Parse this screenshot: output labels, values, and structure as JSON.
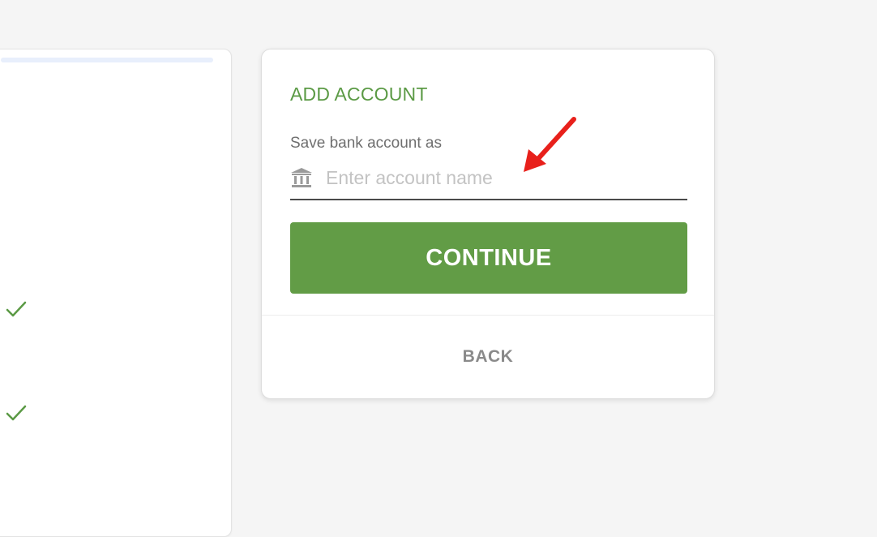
{
  "left_panel": {
    "progress_fraction": 1.0,
    "checks": [
      "check-icon",
      "check-icon"
    ]
  },
  "card": {
    "title": "ADD ACCOUNT",
    "field_label": "Save bank account as",
    "input": {
      "icon": "bank-icon",
      "value": "",
      "placeholder": "Enter account name"
    },
    "continue_label": "CONTINUE",
    "back_label": "BACK"
  },
  "annotation": {
    "icon": "red-arrow-icon",
    "color": "#e8201b"
  },
  "colors": {
    "accent": "#629c46",
    "title": "#5b9a45",
    "background": "#f5f5f5"
  }
}
